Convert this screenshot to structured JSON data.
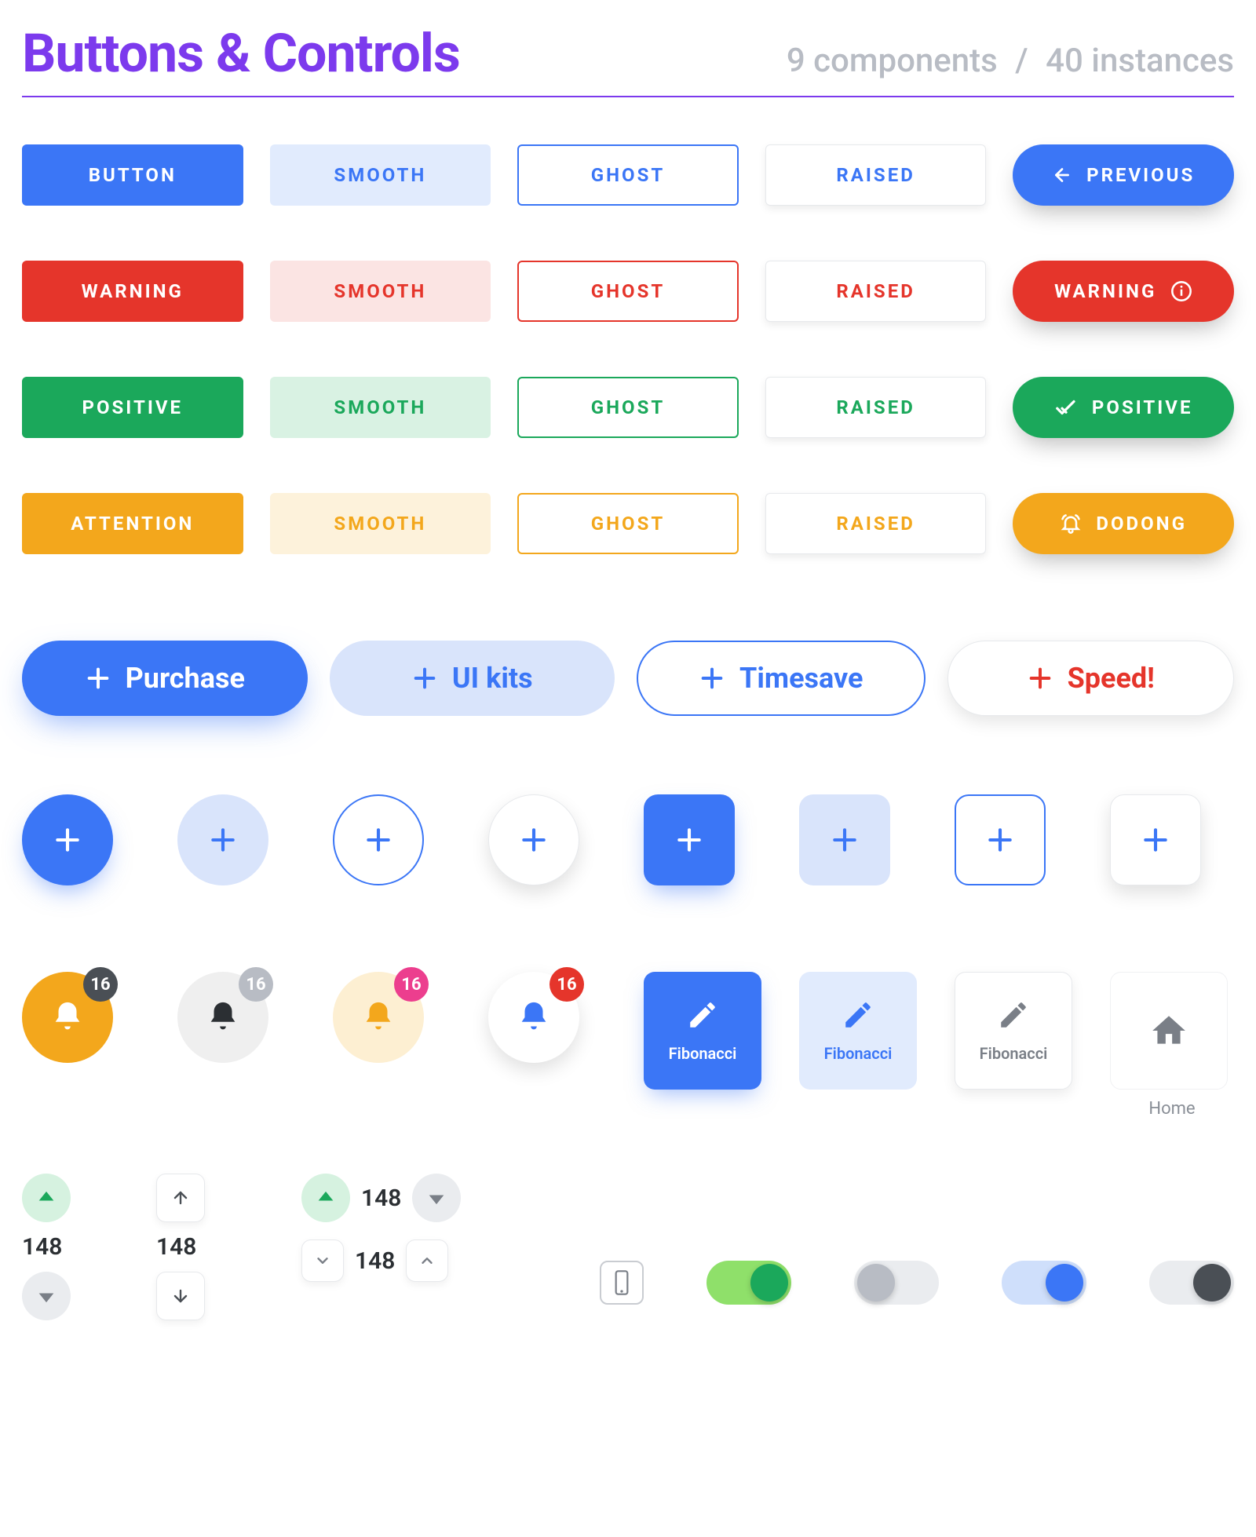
{
  "header": {
    "title": "Buttons & Controls",
    "components": "9 components",
    "sep": "/",
    "instances": "40 instances"
  },
  "rows": {
    "blue": {
      "solid": "BUTTON",
      "smooth": "SMOOTH",
      "ghost": "GHOST",
      "raised": "RAISED",
      "pill": "PREVIOUS"
    },
    "red": {
      "solid": "WARNING",
      "smooth": "SMOOTH",
      "ghost": "GHOST",
      "raised": "RAISED",
      "pill": "WARNING"
    },
    "green": {
      "solid": "POSITIVE",
      "smooth": "SMOOTH",
      "ghost": "GHOST",
      "raised": "RAISED",
      "pill": "POSITIVE"
    },
    "amber": {
      "solid": "ATTENTION",
      "smooth": "SMOOTH",
      "ghost": "GHOST",
      "raised": "RAISED",
      "pill": "DODONG"
    }
  },
  "big": {
    "purchase": "Purchase",
    "uikits": "UI kits",
    "timesave": "Timesave",
    "speed": "Speed!"
  },
  "badges": {
    "b1": "16",
    "b2": "16",
    "b3": "16",
    "b4": "16"
  },
  "tiles": {
    "fib": "Fibonacci",
    "home": "Home"
  },
  "steppers": {
    "a": "148",
    "b": "148",
    "c": "148",
    "d": "148"
  }
}
